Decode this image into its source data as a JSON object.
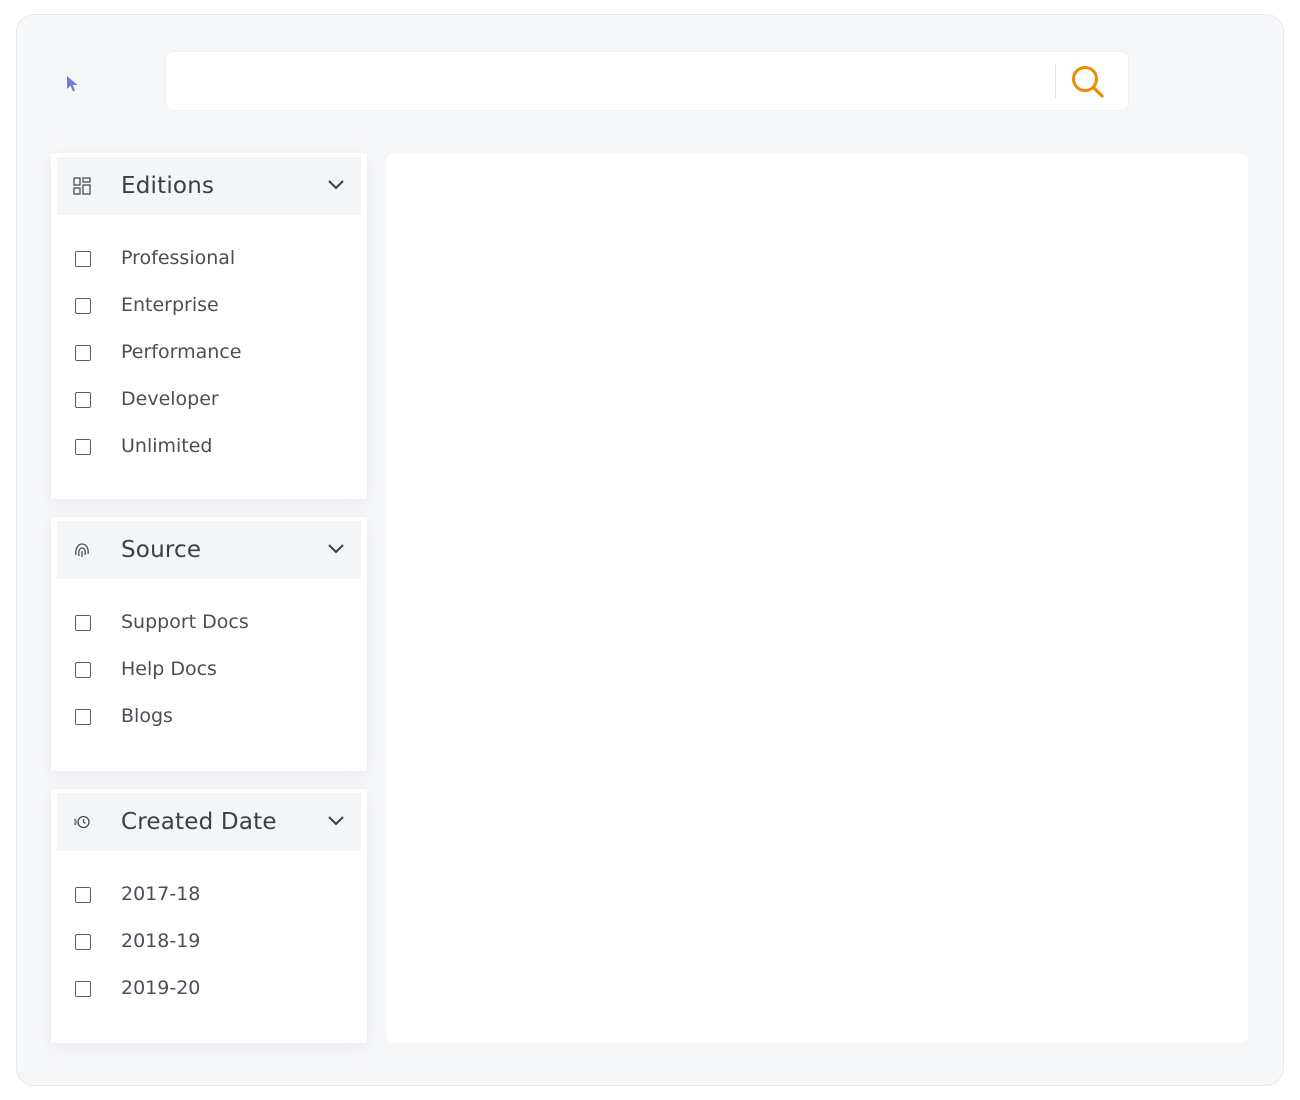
{
  "search": {
    "placeholder": "",
    "value": "",
    "accent": "#f08a00"
  },
  "filters": [
    {
      "title": "Editions",
      "icon": "grid-icon",
      "options": [
        {
          "label": "Professional",
          "checked": false
        },
        {
          "label": "Enterprise",
          "checked": false
        },
        {
          "label": "Performance",
          "checked": false
        },
        {
          "label": "Developer",
          "checked": false
        },
        {
          "label": "Unlimited",
          "checked": false
        }
      ]
    },
    {
      "title": "Source",
      "icon": "fingerprint-icon",
      "options": [
        {
          "label": "Support Docs",
          "checked": false
        },
        {
          "label": "Help Docs",
          "checked": false
        },
        {
          "label": "Blogs",
          "checked": false
        }
      ]
    },
    {
      "title": "Created Date",
      "icon": "history-icon",
      "options": [
        {
          "label": "2017-18",
          "checked": false
        },
        {
          "label": "2018-19",
          "checked": false
        },
        {
          "label": "2019-20",
          "checked": false
        }
      ]
    }
  ],
  "colors": {
    "background": "#f6f7f9",
    "panel": "#ffffff",
    "header": "#f3f5f7",
    "cursor": "#6b7fd7"
  }
}
